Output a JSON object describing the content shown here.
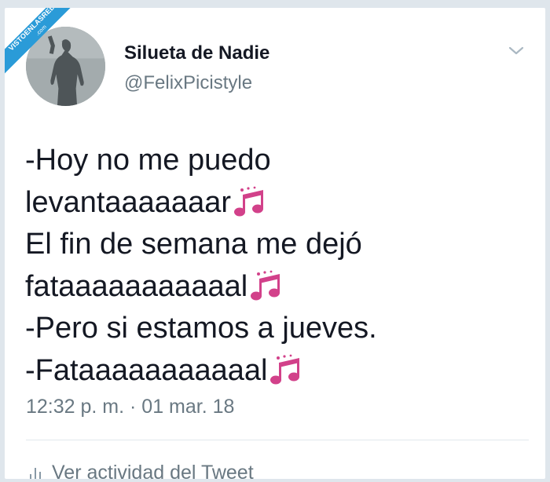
{
  "watermark": {
    "line1": "VISTOENLASREDES",
    "line2": ".com"
  },
  "tweet": {
    "display_name": "Silueta de Nadie",
    "handle": "@FelixPicistyle",
    "lines": [
      "-Hoy no me puedo",
      "levantaaaaaaar",
      "El fin de semana me dejó",
      "fataaaaaaaaaaal",
      "-Pero si estamos a jueves.",
      "-Fataaaaaaaaaaal"
    ],
    "timestamp": "12:32 p. m. · 01 mar. 18",
    "activity_label": "Ver actividad del Tweet"
  },
  "icons": {
    "music": "music-notes-icon",
    "menu": "chevron-down-icon",
    "activity": "bar-chart-icon"
  },
  "colors": {
    "music_note": "#d2418a",
    "text": "#141823",
    "secondary": "#697882",
    "ribbon": "#2a9bd8"
  }
}
